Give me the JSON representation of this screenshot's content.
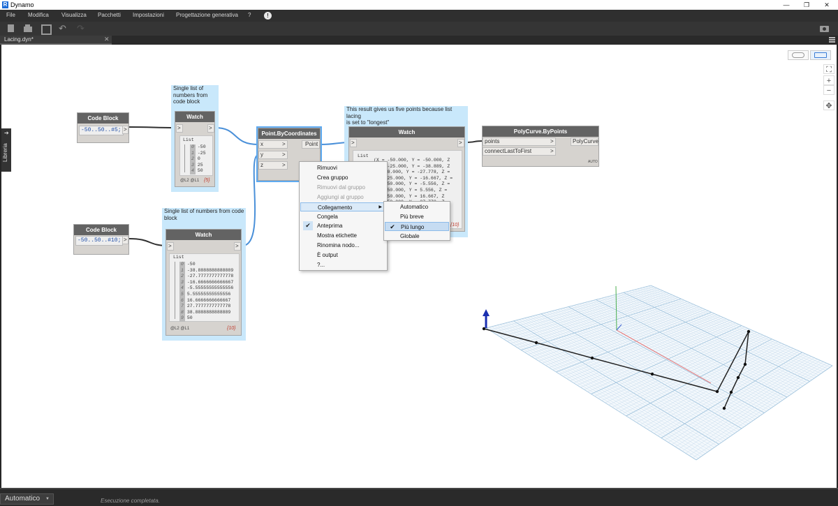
{
  "window": {
    "title": "Dynamo",
    "logo": "R",
    "minimize": "—",
    "restore": "❐",
    "close": "✕"
  },
  "menu": [
    "File",
    "Modifica",
    "Visualizza",
    "Pacchetti",
    "Impostazioni",
    "Progettazione generativa",
    "?"
  ],
  "menu_info": "!",
  "toolbar": {
    "undo": "↶",
    "redo": "↷"
  },
  "tab": {
    "name": "Lacing.dyn*",
    "close": "✕"
  },
  "library": {
    "label": "Libreria",
    "arrow": "➔"
  },
  "zoom": {
    "fit": "⛶",
    "in": "+",
    "out": "−",
    "pan": "✥"
  },
  "groups": [
    {
      "text": "Single list of\nnumbers from\ncode block"
    },
    {
      "text": "Single list of numbers from code\nblock"
    },
    {
      "text": "This result gives us five points because list lacing\nis set to \"longest\""
    }
  ],
  "nodes": {
    "cb1": {
      "title": "Code Block",
      "code": "-50..50..#5;",
      "out": ">"
    },
    "cb2": {
      "title": "Code Block",
      "code": "-50..50..#10;",
      "out": ">"
    },
    "watch1": {
      "title": "Watch",
      "in": ">",
      "out": ">",
      "list_label": "List",
      "items": [
        [
          "0",
          "-50"
        ],
        [
          "1",
          "-25"
        ],
        [
          "2",
          "0"
        ],
        [
          "3",
          "25"
        ],
        [
          "4",
          "50"
        ]
      ],
      "footer": "@L2 @L1",
      "count": "{5}"
    },
    "watch2": {
      "title": "Watch",
      "in": ">",
      "out": ">",
      "list_label": "List",
      "items": [
        [
          "0",
          "-50"
        ],
        [
          "1",
          "-38.8888888888889"
        ],
        [
          "2",
          "-27.7777777777778"
        ],
        [
          "3",
          "-16.6666666666667"
        ],
        [
          "4",
          "-5.55555555555556"
        ],
        [
          "5",
          "5.55555555555556"
        ],
        [
          "6",
          "16.6666666666667"
        ],
        [
          "7",
          "27.7777777777778"
        ],
        [
          "8",
          "38.8888888888889"
        ],
        [
          "9",
          "50"
        ]
      ],
      "footer": "@L2 @L1",
      "count": "{10}"
    },
    "pbc": {
      "title": "Point.ByCoordinates",
      "inputs": [
        "x",
        "y",
        "z"
      ],
      "output": "Point",
      "arrow": ">"
    },
    "watch3": {
      "title": "Watch",
      "in": ">",
      "out": ">",
      "list_label": "List",
      "lines": [
        "(X = -50.000, Y = -50.000, Z",
        "(X = -25.000, Y = -38.889, Z",
        "(X = 0.000, Y = -27.778, Z =",
        "(X = 25.000, Y = -16.667, Z =",
        "(X = 50.000, Y = -5.556, Z =",
        "(X = 50.000, Y = 5.556, Z =",
        "(X = 50.000, Y = 16.667, Z",
        "(X = 50.000, Y = 27.778, Z",
        "(X = 50.000, Y = 38.889, Z",
        "(X = 50.000, Y = 50.000, Z"
      ],
      "count": "{10}"
    },
    "poly": {
      "title": "PolyCurve.ByPoints",
      "inputs": [
        "points",
        "connectLastToFirst"
      ],
      "output": "PolyCurve",
      "arrow": ">",
      "badge": "AUTO"
    }
  },
  "context_menu": {
    "items": [
      {
        "label": "Rimuovi",
        "enabled": true
      },
      {
        "label": "Crea gruppo",
        "enabled": true
      },
      {
        "label": "Rimuovi dal gruppo",
        "enabled": false
      },
      {
        "label": "Aggiungi al gruppo",
        "enabled": false
      },
      {
        "label": "Collegamento",
        "enabled": true,
        "submenu": true,
        "highlighted": true
      },
      {
        "label": "Congela",
        "enabled": true
      },
      {
        "label": "Anteprima",
        "enabled": true,
        "checked": true
      },
      {
        "label": "Mostra etichette",
        "enabled": true
      },
      {
        "label": "Rinomina nodo...",
        "enabled": true
      },
      {
        "label": "È output",
        "enabled": true
      },
      {
        "label": "?...",
        "enabled": true
      }
    ],
    "check": "✔",
    "submenu_arrow": "▶"
  },
  "lacing_submenu": {
    "items": [
      {
        "label": "Automatico"
      },
      {
        "label": "Più breve"
      },
      {
        "label": "Più lungo",
        "checked": true,
        "highlighted": true
      },
      {
        "label": "Globale"
      }
    ],
    "check": "✔"
  },
  "status": {
    "run_mode": "Automatico",
    "dropdown": "▼",
    "message": "Esecuzione completata."
  },
  "colors": {
    "group": "#c9e8fb",
    "wire": "#2f2f2f",
    "wire_selected": "#4a90d9",
    "node_header": "#636363",
    "node_body": "#d6d3cf",
    "background_grid": "#b9d4e6"
  }
}
